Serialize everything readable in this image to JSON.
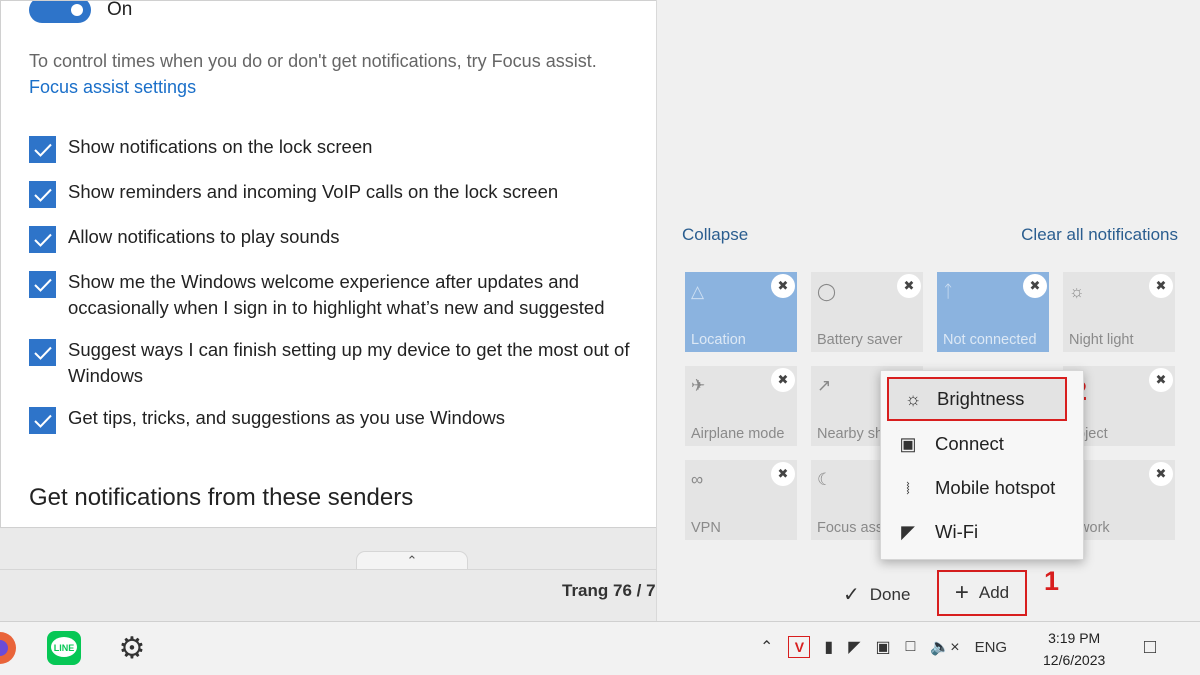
{
  "settings": {
    "toggle_label": "On",
    "focus_text": "To control times when you do or don't get notifications, try Focus assist.",
    "focus_link": "Focus assist settings",
    "checkboxes": [
      {
        "label": "Show notifications on the lock screen",
        "checked": true
      },
      {
        "label": "Show reminders and incoming VoIP calls on the lock screen",
        "checked": true
      },
      {
        "label": "Allow notifications to play sounds",
        "checked": true
      },
      {
        "label": "Show me the Windows welcome experience after updates and occasionally when I sign in to highlight what’s new and suggested",
        "checked": true
      },
      {
        "label": "Suggest ways I can finish setting up my device to get the most out of Windows",
        "checked": true
      },
      {
        "label": "Get tips, tricks, and suggestions as you use Windows",
        "checked": true
      }
    ],
    "senders_heading": "Get notifications from these senders"
  },
  "doc": {
    "page_indicator": "Trang 76 / 7"
  },
  "action_center": {
    "collapse": "Collapse",
    "clear_all": "Clear all notifications",
    "tiles": [
      {
        "label": "Location",
        "icon": "location-icon",
        "active": true
      },
      {
        "label": "Battery saver",
        "icon": "battery-saver-icon",
        "active": false
      },
      {
        "label": "Not connected",
        "icon": "bluetooth-icon",
        "active": true
      },
      {
        "label": "Night light",
        "icon": "night-light-icon",
        "active": false
      },
      {
        "label": "Airplane mode",
        "icon": "airplane-icon",
        "active": false
      },
      {
        "label": "Nearby sh",
        "icon": "nearby-sharing-icon",
        "active": false
      },
      {
        "label": "oject",
        "icon": "project-icon",
        "active": false
      },
      {
        "label": "VPN",
        "icon": "vpn-icon",
        "active": false
      },
      {
        "label": "Focus ass",
        "icon": "focus-assist-icon",
        "active": false
      },
      {
        "label": "twork",
        "icon": "network-icon",
        "active": false
      }
    ],
    "done": "Done",
    "add": "Add",
    "callout_1": "1",
    "callout_2": "2"
  },
  "menu": {
    "items": [
      {
        "label": "Brightness",
        "icon": "brightness-icon",
        "highlighted": true
      },
      {
        "label": "Connect",
        "icon": "connect-icon",
        "highlighted": false
      },
      {
        "label": "Mobile hotspot",
        "icon": "mobile-hotspot-icon",
        "highlighted": false
      },
      {
        "label": "Wi-Fi",
        "icon": "wifi-icon",
        "highlighted": false
      }
    ]
  },
  "taskbar": {
    "line_app": "LINE",
    "language": "ENG",
    "time": "3:19 PM",
    "date": "12/6/2023",
    "tray_v": "V"
  },
  "colors": {
    "accent": "#2e74c9",
    "tile_active": "#8bb3df",
    "callout_red": "#d81e1e",
    "line_green": "#06c755"
  }
}
